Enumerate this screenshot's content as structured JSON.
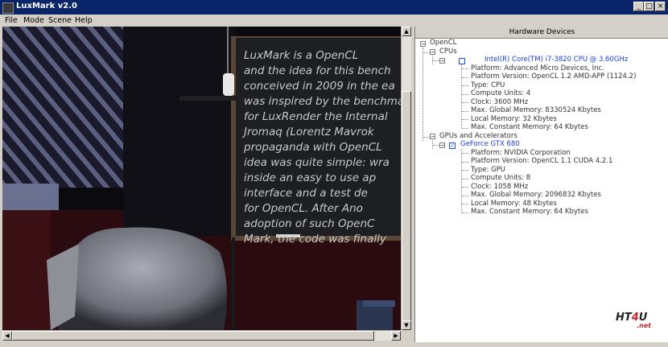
{
  "window": {
    "title": "LuxMark v2.0"
  },
  "menu": [
    "File",
    "Mode",
    "Scene",
    "Help"
  ],
  "scene_text": [
    "LuxMark is a OpenCL",
    "and the idea for this bench",
    "conceived in 2009 in the ea",
    "was inspired by the benchma",
    "for LuxRender the Internal",
    "Jromaq (Lorentz Mavrok",
    "propaganda with OpenCL",
    "idea was quite simple: wra",
    "inside an easy to use ap",
    "interface and a test de",
    "for OpenCL. After Ano",
    "adoption of such OpenC",
    "Mark, the code was finally"
  ],
  "panel": {
    "header": "Hardware Devices"
  },
  "tree": {
    "root": "OpenCL",
    "cpu_group": "CPUs",
    "cpu": {
      "name": "Intel(R) Core(TM) i7-3820 CPU @ 3.60GHz",
      "checked": false,
      "props": [
        "Platform: Advanced Micro Devices, Inc.",
        "Platform Version: OpenCL 1.2 AMD-APP (1124.2)",
        "Type: CPU",
        "Compute Units: 4",
        "Clock: 3600 MHz",
        "Max. Global Memory: 8330524 Kbytes",
        "Local Memory: 32 Kbytes",
        "Max. Constant Memory: 64 Kbytes"
      ]
    },
    "gpu_group": "GPUs and Accelerators",
    "gpu": {
      "name": "GeForce GTX 680",
      "checked": true,
      "props": [
        "Platform: NVIDIA Corporation",
        "Platform Version: OpenCL 1.1 CUDA 4.2.1",
        "Type: GPU",
        "Compute Units: 8",
        "Clock: 1058 MHz",
        "Max. Global Memory: 2096832 Kbytes",
        "Local Memory: 48 Kbytes",
        "Max. Constant Memory: 64 Kbytes"
      ]
    }
  },
  "watermark": {
    "main_a": "HT",
    "main_b": "4",
    "main_c": "U",
    "sub": ".net"
  }
}
